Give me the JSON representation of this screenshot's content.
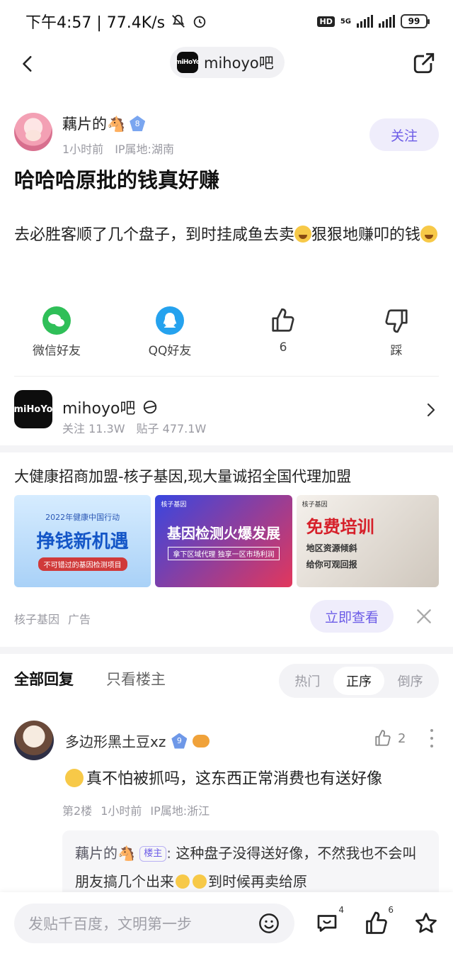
{
  "status_bar": {
    "time_speed": "下午4:57 | 77.4K/s",
    "network": "5G",
    "hd": "HD",
    "battery": "99"
  },
  "nav": {
    "forum_name": "mihoyo吧",
    "forum_logo_text": "miHoYo"
  },
  "post": {
    "author": {
      "name": "藕片的🐴",
      "level": "8",
      "time": "1小时前",
      "ip": "IP属地:湖南"
    },
    "follow_label": "关注",
    "title": "哈哈哈原批的钱真好赚",
    "body_part1": "去必胜客顺了几个盘子，到时挂咸鱼去卖",
    "body_part2": "狠狠地赚叩的钱",
    "share_actions": [
      {
        "label": "微信好友",
        "icon": "wechat-icon"
      },
      {
        "label": "QQ好友",
        "icon": "qq-icon"
      },
      {
        "label": "6",
        "icon": "thumb-up-icon"
      },
      {
        "label": "踩",
        "icon": "thumb-down-icon"
      }
    ]
  },
  "forum_card": {
    "name": "mihoyo吧",
    "logo_text": "miHoYo",
    "followers": "关注 11.3W",
    "posts": "贴子 477.1W"
  },
  "ad": {
    "title": "大健康招商加盟-核子基因,现大量诚招全国代理加盟",
    "img1": {
      "sub": "2022年健康中国行动",
      "main": "挣钱新机遇",
      "strip": "不可错过的基因检测项目"
    },
    "img2": {
      "brand": "核子基因",
      "main": "基因检测火爆发展",
      "strip": "拿下区域代理 独享一区市场利润"
    },
    "img3": {
      "brand": "核子基因",
      "main": "免费培训",
      "line1": "地区资源倾斜",
      "line2": "给你可观回报"
    },
    "source": "核子基因",
    "ad_label": "广告",
    "cta": "立即查看"
  },
  "replies": {
    "tab_all": "全部回复",
    "tab_op": "只看楼主",
    "sort": [
      "热门",
      "正序",
      "倒序"
    ],
    "sort_active": 1
  },
  "reply": {
    "name": "多边形黑土豆xz",
    "level": "9",
    "likes": "2",
    "text": "真不怕被抓吗，这东西正常消费也有送好像",
    "floor": "第2楼",
    "time": "1小时前",
    "ip": "IP属地:浙江"
  },
  "subreply": {
    "author": "藕片的🐴",
    "host_tag": "楼主",
    "colon": ":",
    "text_part1": "这种盘子没得送好像，不然我也不会叫朋友搞几个出来",
    "text_part2": "到时候再卖给原"
  },
  "bottom_bar": {
    "placeholder": "发贴千百度，文明第一步",
    "comment_count": "4",
    "like_count": "6"
  },
  "colors": {
    "accent": "#6c5ce7",
    "accent_bg": "#efedfb",
    "muted": "#9a9aa2"
  }
}
